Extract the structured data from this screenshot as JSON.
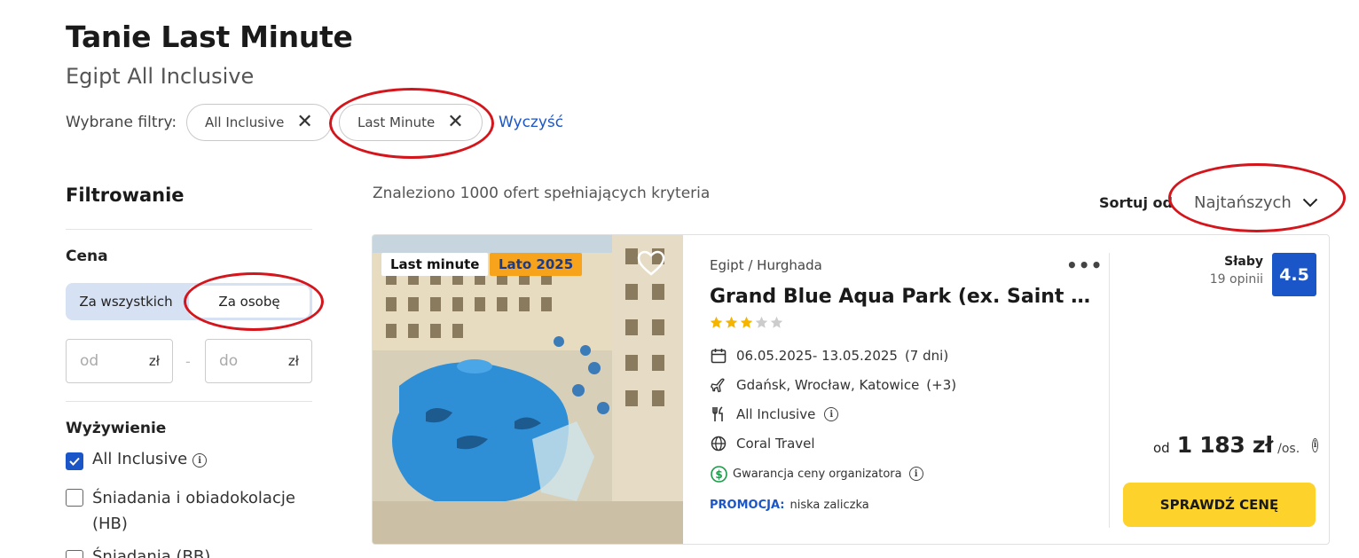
{
  "header": {
    "title": "Tanie Last Minute",
    "subtitle": "Egipt All Inclusive"
  },
  "selected_filters": {
    "label": "Wybrane filtry:",
    "chips": [
      "All Inclusive",
      "Last Minute"
    ],
    "clear_label": "Wyczyść"
  },
  "sidebar": {
    "title": "Filtrowanie",
    "price": {
      "label": "Cena",
      "toggle_options": [
        "Za wszystkich",
        "Za osobę"
      ],
      "toggle_selected": "Za osobę",
      "from_placeholder": "od",
      "to_placeholder": "do",
      "currency": "zł",
      "separator": "-"
    },
    "board": {
      "label": "Wyżywienie",
      "options": [
        {
          "label": "All Inclusive",
          "checked": true
        },
        {
          "label": "Śniadania i obiadokolacje (HB)",
          "checked": false
        },
        {
          "label": "Śniadania (BB)",
          "checked": false
        }
      ]
    }
  },
  "results": {
    "count_text": "Znaleziono 1000 ofert spełniających kryteria",
    "sort_label": "Sortuj od",
    "sort_value": "Najtańszych"
  },
  "offer": {
    "badges": [
      "Last minute",
      "Lato 2025"
    ],
    "location": "Egipt / Hurghada",
    "name": "Grand Blue Aqua Park (ex. Saint Maria)",
    "stars": 3,
    "max_stars": 5,
    "dates": "06.05.2025- 13.05.2025",
    "duration": "(7 dni)",
    "departures": "Gdańsk, Wrocław, Katowice",
    "departures_more": "(+3)",
    "board": "All Inclusive",
    "operator": "Coral Travel",
    "guarantee": "Gwarancja ceny organizatora",
    "promo_label": "PROMOCJA:",
    "promo_text": "niska zaliczka",
    "rating_word": "Słaby",
    "reviews": "19 opinii",
    "rating_value": "4.5",
    "price_prefix": "od",
    "price": "1 183 zł",
    "price_suffix": "/os.",
    "cta_label": "SPRAWDŹ CENĘ"
  },
  "colors": {
    "accent_blue": "#1a56c8",
    "cta_yellow": "#fcd22b",
    "badge_orange": "#f7a31b",
    "highlight_red": "#d4151b",
    "star_gold": "#f5b400"
  },
  "icons": [
    "close-icon",
    "chevron-down-icon",
    "heart-icon",
    "more-icon",
    "calendar-icon",
    "plane-icon",
    "fork-knife-icon",
    "globe-icon",
    "dollar-circle-icon",
    "info-icon",
    "check-icon",
    "star-icon"
  ]
}
